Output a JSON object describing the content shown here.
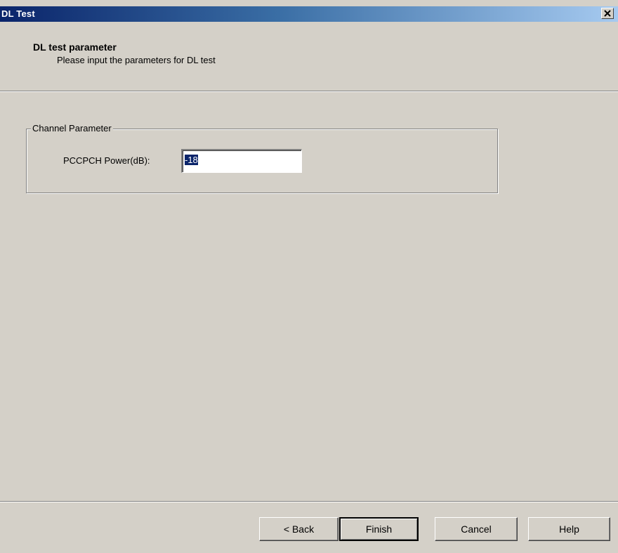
{
  "window": {
    "title": "DL Test"
  },
  "header": {
    "title": "DL test parameter",
    "subtitle": "Please input the parameters for DL test"
  },
  "group": {
    "legend": "Channel Parameter",
    "field_label": "PCCPCH Power(dB):",
    "field_value": "-18"
  },
  "buttons": {
    "back": "< Back",
    "finish": "Finish",
    "cancel": "Cancel",
    "help": "Help"
  },
  "colors": {
    "titlebar_start": "#0a246a",
    "titlebar_end": "#a6caf0",
    "face": "#d4d0c8",
    "selection": "#0a246a"
  }
}
